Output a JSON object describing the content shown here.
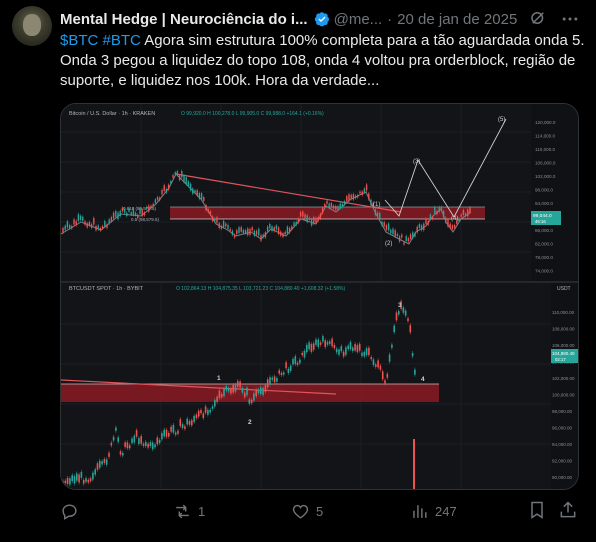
{
  "tweet": {
    "author_name": "Mental Hedge | Neurociência do i...",
    "handle": "@me...",
    "separator": "·",
    "date": "20 de jan de 2025",
    "hashtag1": "$BTC",
    "hashtag2": "#BTC",
    "body": " Agora sim estrutura 100% completa para a tão aguardada onda 5. Onda 3 pegou a liquidez do topo 108, onda 4 voltou pra orderblock, região de suporte, e liquidez nos 100k. Hora da verdade..."
  },
  "chart_top": {
    "title": "Bitcoin / U.S. Dollar · 1h · KRAKEN",
    "ohlc_text": "O 99,920.0  H 100,278.0  L 99,905.0  C 99,988.0  +164.1 (+0.16%)",
    "fib_labels": [
      "0.618 (99,579.5)",
      "0.5 (98,579.5)"
    ],
    "price_badge": "99,044.0",
    "price_badge_sub": "46:16",
    "axis_ticks": [
      "120,000.0",
      "114,000.0",
      "110,000.0",
      "106,000.0",
      "102,000.0",
      "98,000.0",
      "94,000.0",
      "90,000.0",
      "86,000.0",
      "82,000.0",
      "78,000.0",
      "74,000.0"
    ],
    "wave_labels": [
      "(1)",
      "(2)",
      "(3)",
      "(4)",
      "(5)"
    ]
  },
  "chart_bottom": {
    "title": "BTCUSDT SPOT · 1h · BYBIT",
    "ohlc_text": "O 102,864.13  H 104,875.35  L 103,721.23  C 104,880.40  +1,608.32 (+1.58%)",
    "currency": "USDT",
    "price_badge": "104,880.40",
    "price_badge_sub": "02:17",
    "axis_ticks": [
      "110,000.00",
      "108,000.00",
      "106,000.00",
      "104,000.00",
      "102,000.00",
      "100,000.00",
      "98,000.00",
      "96,000.00",
      "94,000.00",
      "92,000.00",
      "90,000.00"
    ],
    "wave_labels": [
      "1",
      "2",
      "3",
      "4"
    ]
  },
  "actions": {
    "reply_count": "",
    "retweet_count": "1",
    "like_count": "5",
    "views_count": "247"
  },
  "colors": {
    "accent": "#1d9bf0",
    "up_candle": "#26a69a",
    "down_candle": "#ef5350",
    "zone": "#8b1a25"
  }
}
